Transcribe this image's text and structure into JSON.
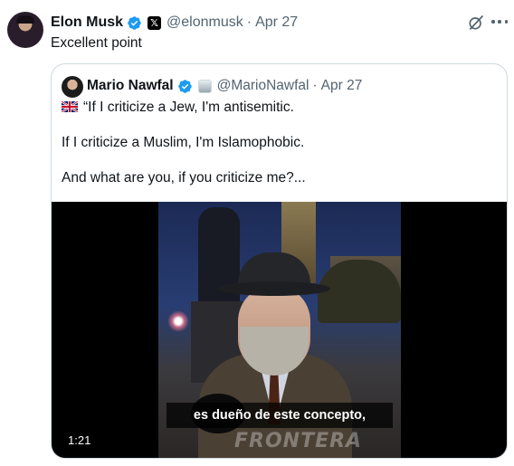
{
  "tweet": {
    "author_name": "Elon Musk",
    "handle": "@elonmusk",
    "separator": "·",
    "date": "Apr 27",
    "affiliate_badge": "𝕏",
    "text": "Excellent point"
  },
  "quoted_tweet": {
    "author_name": "Mario Nawfal",
    "handle": "@MarioNawfal",
    "separator": "·",
    "date": "Apr 27",
    "lines": [
      "“If I criticize a Jew, I'm antisemitic.",
      "If I criticize a Muslim, I'm Islamophobic.",
      "And what are you, if you criticize me?..."
    ],
    "video": {
      "subtitle": "es dueño de este concepto,",
      "duration": "1:21",
      "watermark": "FRONTERA"
    }
  },
  "colors": {
    "verified_blue": "#1d9bf0",
    "muted_text": "#536471",
    "border": "#cfd9de"
  },
  "icons": [
    "verified-icon",
    "x-affiliate-icon",
    "grok-icon",
    "more-icon",
    "uk-flag-icon"
  ]
}
